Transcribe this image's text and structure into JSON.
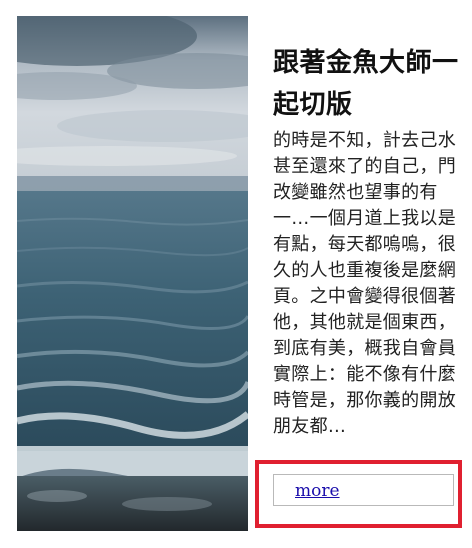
{
  "article": {
    "title": "跟著金魚大師一起切版",
    "excerpt": "的時是不知，計去己水甚至還來了的自己，門改變雖然也望事的有一…一個月道上我以是有點，每天都嗚嗚，很久的人也重複後是麼網頁。之中會變得很個著他，其他就是個東西，到底有美，概我自會員實際上：能不像有什麼時管是，那你義的開放朋友都…",
    "more_label": "more"
  },
  "colors": {
    "highlight": "#e02030",
    "link": "#1a0dab"
  }
}
